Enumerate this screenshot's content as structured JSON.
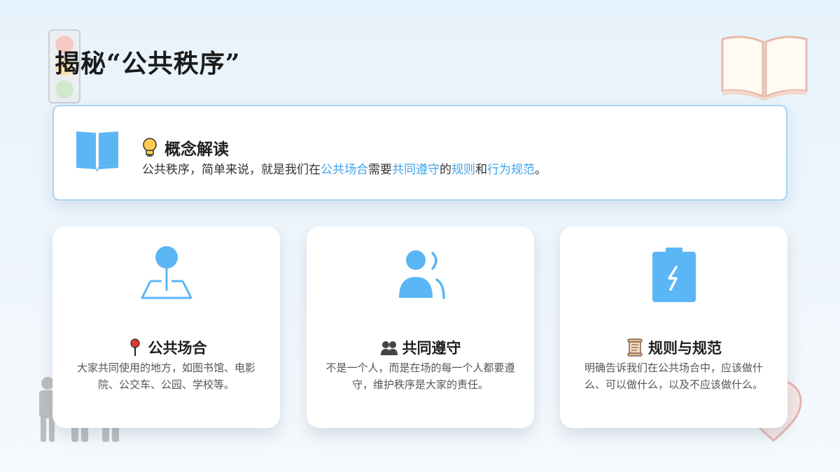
{
  "slide": {
    "title": "揭秘“公共秩序”"
  },
  "concept": {
    "title": "概念解读",
    "text_parts": [
      "公共秩序，简单来说，就是我们在",
      "公共场合",
      "需要",
      "共同遵守",
      "的",
      "规则",
      "和",
      "行为规范",
      "。"
    ]
  },
  "cards": [
    {
      "icon": "map-pin-icon",
      "emoji": "pushpin-icon",
      "title": "公共场合",
      "text": "大家共同使用的地方，如图书馆、电影院、公交车、公园、学校等。"
    },
    {
      "icon": "people-icon",
      "emoji": "group-silhouette-icon",
      "title": "共同遵守",
      "text": "不是一个人，而是在场的每一个人都要遵守，维护秩序是大家的责任。"
    },
    {
      "icon": "clipboard-lightning-icon",
      "emoji": "scroll-icon",
      "title": "规则与规范",
      "text": "明确告诉我们在公共场合中，应该做什么、可以做什么，以及不应该做什么。"
    }
  ],
  "colors": {
    "accent": "#3ea4ea",
    "icon_blue": "#5ab6f4",
    "card_border": "#a9d4f2"
  }
}
